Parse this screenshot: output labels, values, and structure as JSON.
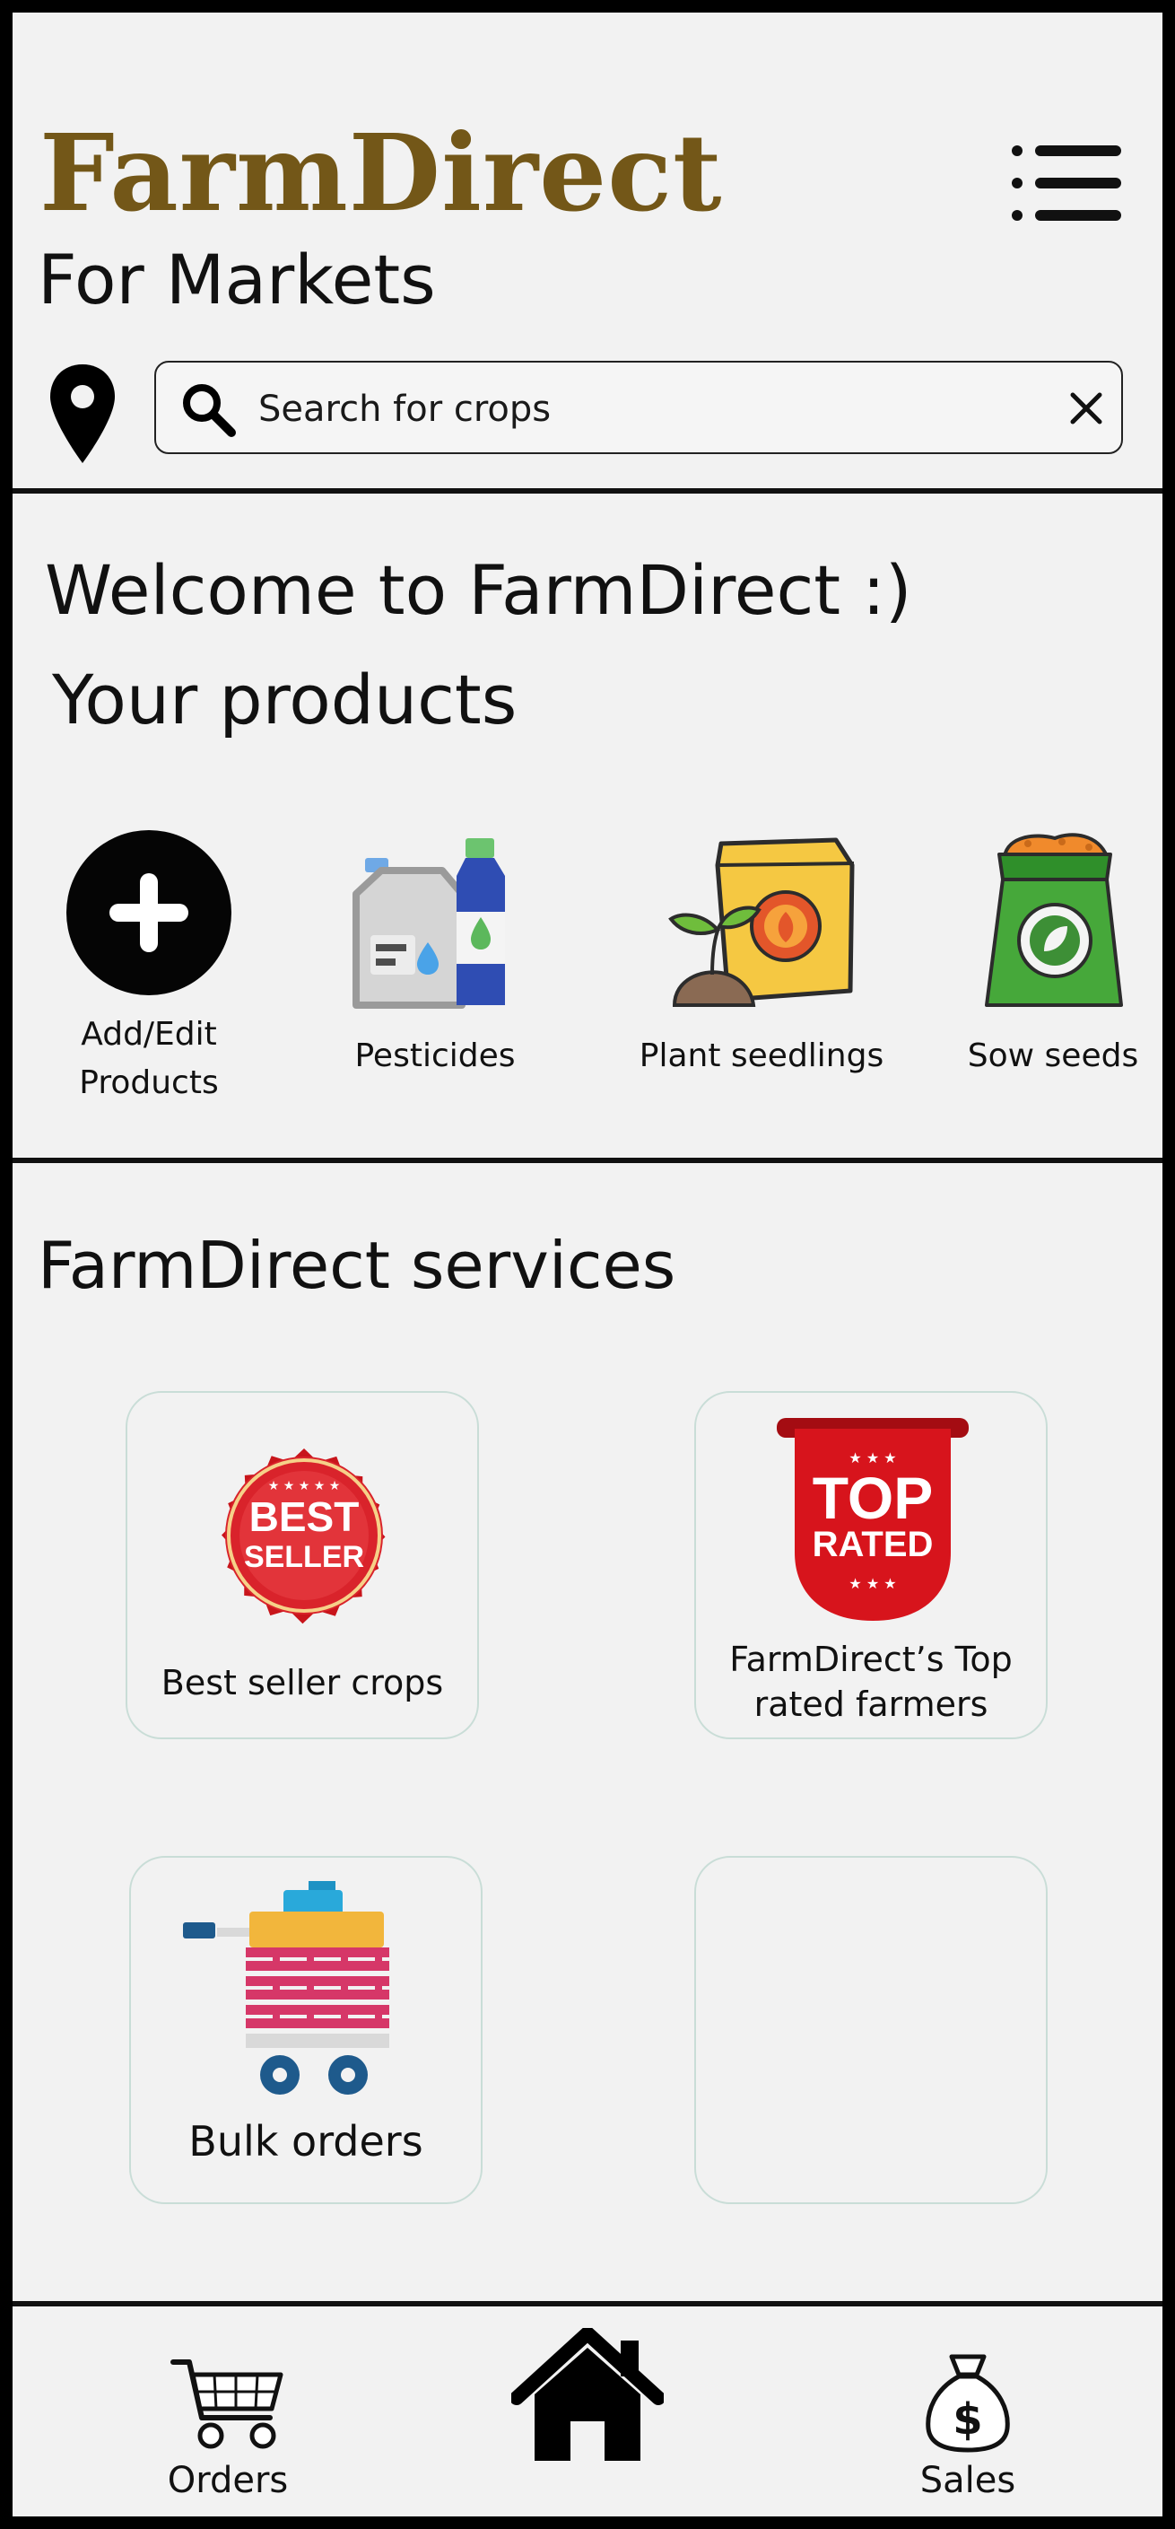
{
  "header": {
    "brand": "FarmDirect",
    "subtitle": "For Markets",
    "brand_color": "#735718"
  },
  "search": {
    "placeholder": "Search for crops",
    "value": ""
  },
  "welcome": {
    "greeting": "Welcome to FarmDirect :)",
    "products_title": "Your products"
  },
  "products": [
    {
      "label_line1": "Add/Edit",
      "label_line2": "Products",
      "icon": "plus-circle-icon"
    },
    {
      "label": "Pesticides",
      "icon": "pesticide-bottles-icon"
    },
    {
      "label": "Plant seedlings",
      "icon": "seedling-sack-icon"
    },
    {
      "label": "Sow seeds",
      "icon": "seed-bag-icon"
    }
  ],
  "services": {
    "title": "FarmDirect services",
    "items": [
      {
        "label": "Best seller crops",
        "badge_line1": "BEST",
        "badge_line2": "SELLER",
        "icon": "best-seller-badge-icon"
      },
      {
        "label_line1": "FarmDirect’s Top",
        "label_line2": "rated farmers",
        "badge_line1": "TOP",
        "badge_line2": "RATED",
        "icon": "top-rated-ribbon-icon"
      },
      {
        "label": "Bulk orders",
        "icon": "cart-boxes-icon"
      },
      {
        "label": "",
        "icon": ""
      }
    ]
  },
  "bottom_nav": {
    "orders": "Orders",
    "sales": "Sales"
  },
  "colors": {
    "background": "#f2f2f2",
    "frame": "#000000",
    "accent_red": "#d7141c",
    "bag_green": "#46a83a",
    "bag_yellow": "#f3c43a"
  }
}
